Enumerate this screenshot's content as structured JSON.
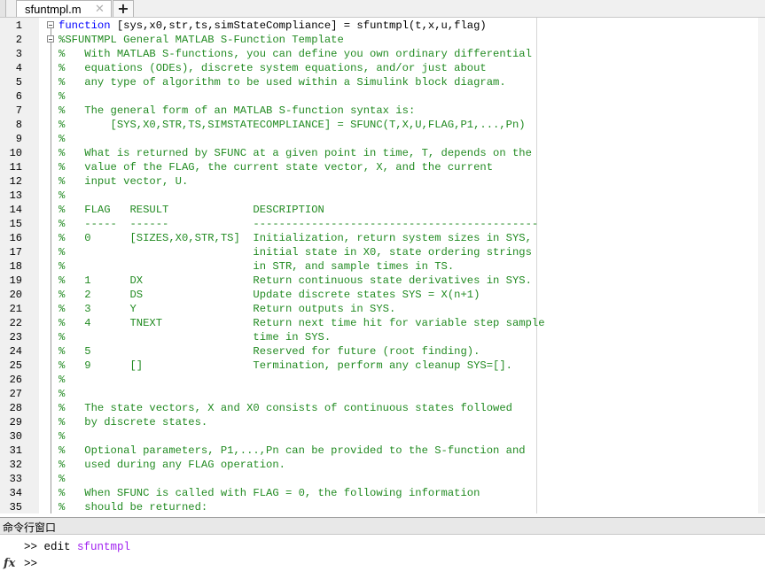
{
  "tab": {
    "label": "sfuntmpl.m",
    "close_glyph": "✕",
    "add_glyph": "+"
  },
  "editor": {
    "lines": [
      {
        "n": "1",
        "parts": [
          [
            "kw",
            "function"
          ],
          [
            "pl",
            " [sys,x0,str,ts,simStateCompliance] = sfuntmpl(t,x,u,flag)"
          ]
        ],
        "fold": true
      },
      {
        "n": "2",
        "parts": [
          [
            "cm",
            "%SFUNTMPL General MATLAB S-Function Template"
          ]
        ],
        "fold": true
      },
      {
        "n": "3",
        "parts": [
          [
            "cm",
            "%   With MATLAB S-functions, you can define you own ordinary differential"
          ]
        ]
      },
      {
        "n": "4",
        "parts": [
          [
            "cm",
            "%   equations (ODEs), discrete system equations, and/or just about"
          ]
        ]
      },
      {
        "n": "5",
        "parts": [
          [
            "cm",
            "%   any type of algorithm to be used within a Simulink block diagram."
          ]
        ]
      },
      {
        "n": "6",
        "parts": [
          [
            "cm",
            "%"
          ]
        ]
      },
      {
        "n": "7",
        "parts": [
          [
            "cm",
            "%   The general form of an MATLAB S-function syntax is:"
          ]
        ]
      },
      {
        "n": "8",
        "parts": [
          [
            "cm",
            "%       [SYS,X0,STR,TS,SIMSTATECOMPLIANCE] = SFUNC(T,X,U,FLAG,P1,...,Pn)"
          ]
        ]
      },
      {
        "n": "9",
        "parts": [
          [
            "cm",
            "%"
          ]
        ]
      },
      {
        "n": "10",
        "parts": [
          [
            "cm",
            "%   What is returned by SFUNC at a given point in time, T, depends on the"
          ]
        ]
      },
      {
        "n": "11",
        "parts": [
          [
            "cm",
            "%   value of the FLAG, the current state vector, X, and the current"
          ]
        ]
      },
      {
        "n": "12",
        "parts": [
          [
            "cm",
            "%   input vector, U."
          ]
        ]
      },
      {
        "n": "13",
        "parts": [
          [
            "cm",
            "%"
          ]
        ]
      },
      {
        "n": "14",
        "parts": [
          [
            "cm",
            "%   FLAG   RESULT             DESCRIPTION"
          ]
        ]
      },
      {
        "n": "15",
        "parts": [
          [
            "cm",
            "%   -----  ------             --------------------------------------------"
          ]
        ]
      },
      {
        "n": "16",
        "parts": [
          [
            "cm",
            "%   0      [SIZES,X0,STR,TS]  Initialization, return system sizes in SYS,"
          ]
        ]
      },
      {
        "n": "17",
        "parts": [
          [
            "cm",
            "%                             initial state in X0, state ordering strings"
          ]
        ]
      },
      {
        "n": "18",
        "parts": [
          [
            "cm",
            "%                             in STR, and sample times in TS."
          ]
        ]
      },
      {
        "n": "19",
        "parts": [
          [
            "cm",
            "%   1      DX                 Return continuous state derivatives in SYS."
          ]
        ]
      },
      {
        "n": "20",
        "parts": [
          [
            "cm",
            "%   2      DS                 Update discrete states SYS = X(n+1)"
          ]
        ]
      },
      {
        "n": "21",
        "parts": [
          [
            "cm",
            "%   3      Y                  Return outputs in SYS."
          ]
        ]
      },
      {
        "n": "22",
        "parts": [
          [
            "cm",
            "%   4      TNEXT              Return next time hit for variable step sample"
          ]
        ]
      },
      {
        "n": "23",
        "parts": [
          [
            "cm",
            "%                             time in SYS."
          ]
        ]
      },
      {
        "n": "24",
        "parts": [
          [
            "cm",
            "%   5                         Reserved for future (root finding)."
          ]
        ]
      },
      {
        "n": "25",
        "parts": [
          [
            "cm",
            "%   9      []                 Termination, perform any cleanup SYS=[]."
          ]
        ]
      },
      {
        "n": "26",
        "parts": [
          [
            "cm",
            "%"
          ]
        ]
      },
      {
        "n": "27",
        "parts": [
          [
            "cm",
            "%"
          ]
        ]
      },
      {
        "n": "28",
        "parts": [
          [
            "cm",
            "%   The state vectors, X and X0 consists of continuous states followed"
          ]
        ]
      },
      {
        "n": "29",
        "parts": [
          [
            "cm",
            "%   by discrete states."
          ]
        ]
      },
      {
        "n": "30",
        "parts": [
          [
            "cm",
            "%"
          ]
        ]
      },
      {
        "n": "31",
        "parts": [
          [
            "cm",
            "%   Optional parameters, P1,...,Pn can be provided to the S-function and"
          ]
        ]
      },
      {
        "n": "32",
        "parts": [
          [
            "cm",
            "%   used during any FLAG operation."
          ]
        ]
      },
      {
        "n": "33",
        "parts": [
          [
            "cm",
            "%"
          ]
        ]
      },
      {
        "n": "34",
        "parts": [
          [
            "cm",
            "%   When SFUNC is called with FLAG = 0, the following information"
          ]
        ]
      },
      {
        "n": "35",
        "parts": [
          [
            "cm",
            "%   should be returned:"
          ]
        ]
      }
    ]
  },
  "command_window": {
    "title": "命令行窗口",
    "history_prompt": ">> ",
    "history_cmd": "edit ",
    "history_arg": "sfuntmpl",
    "current_prompt": ">>",
    "fx_label": "fx"
  },
  "colors": {
    "keyword": "#0000ff",
    "comment": "#228b22",
    "string_arg": "#a020f0"
  }
}
